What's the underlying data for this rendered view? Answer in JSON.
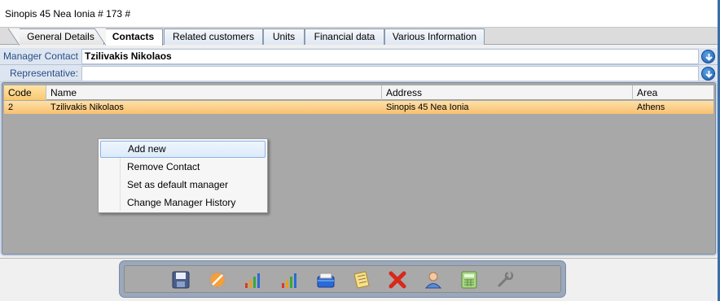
{
  "window": {
    "title": "Sinopis 45 Nea Ionia # 173 #"
  },
  "tabs": [
    {
      "label": "General Details"
    },
    {
      "label": "Contacts"
    },
    {
      "label": "Related customers"
    },
    {
      "label": "Units"
    },
    {
      "label": "Financial data"
    },
    {
      "label": "Various Information"
    }
  ],
  "fields": {
    "manager_contact": {
      "label": "Manager Contact :",
      "value": "Tzilivakis Nikolaos"
    },
    "representative": {
      "label": "Representative:",
      "value": ""
    }
  },
  "grid": {
    "columns": [
      "Code",
      "Name",
      "Address",
      "Area"
    ],
    "rows": [
      {
        "code": "2",
        "name": "Tzilivakis Nikolaos",
        "address": "Sinopis 45 Nea Ionia",
        "area": "Athens"
      }
    ]
  },
  "context_menu": {
    "items": [
      {
        "label": "Add new"
      },
      {
        "label": "Remove Contact"
      },
      {
        "label": "Set as default manager"
      },
      {
        "label": "Change Manager History"
      }
    ]
  },
  "toolbar": {
    "buttons": [
      {
        "icon": "save-icon"
      },
      {
        "icon": "cancel-edit-icon"
      },
      {
        "icon": "chart-icon"
      },
      {
        "icon": "chart-alt-icon"
      },
      {
        "icon": "folder-icon"
      },
      {
        "icon": "notes-icon"
      },
      {
        "icon": "delete-icon"
      },
      {
        "icon": "user-icon"
      },
      {
        "icon": "calculator-icon"
      },
      {
        "icon": "tools-icon"
      }
    ]
  },
  "colors": {
    "accent": "#3a6ea8",
    "row_highlight": "#f8c070",
    "label_text": "#2a4f8a"
  }
}
